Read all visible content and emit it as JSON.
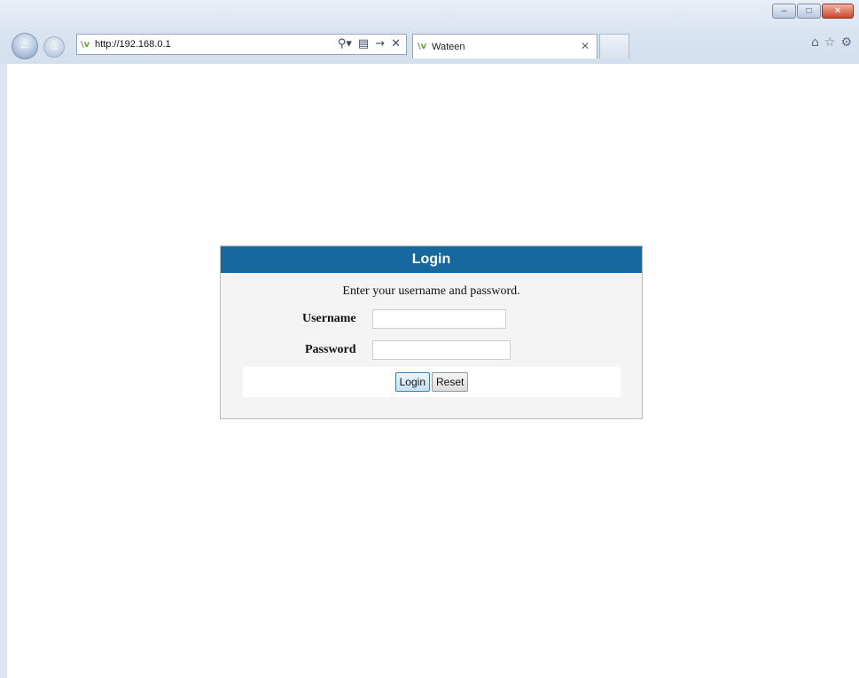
{
  "browser": {
    "address_url": "http://192.168.0.1",
    "tab_title": "Wateen",
    "favicon_text": "\\v",
    "icons": [
      "back-icon",
      "forward-icon",
      "search-icon",
      "compat-icon",
      "go-icon",
      "stop-icon",
      "home-icon",
      "favorites-icon",
      "tools-icon"
    ],
    "window_controls": [
      "minimize",
      "maximize",
      "close"
    ]
  },
  "login": {
    "title": "Login",
    "instructions": "Enter your username and password.",
    "username_label": "Username",
    "username_value": "",
    "password_label": "Password",
    "password_value": "",
    "login_button": "Login",
    "reset_button": "Reset",
    "header_color": "#17689c"
  }
}
